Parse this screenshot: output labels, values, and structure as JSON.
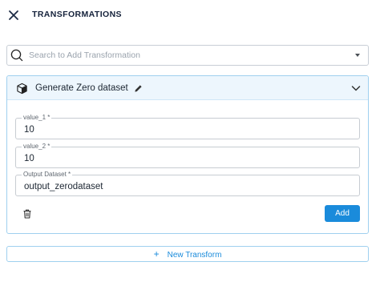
{
  "header": {
    "title": "TRANSFORMATIONS"
  },
  "search": {
    "placeholder": "Search to Add Transformation"
  },
  "card": {
    "title": "Generate Zero dataset",
    "fields": [
      {
        "label": "value_1 *",
        "value": "10"
      },
      {
        "label": "value_2 *",
        "value": "10"
      },
      {
        "label": "Output Dataset *",
        "value": "output_zerodataset"
      }
    ],
    "add_label": "Add"
  },
  "footer": {
    "plus": "+",
    "new_transform_label": "New Transform"
  },
  "colors": {
    "accent": "#1a8bdb",
    "card_border": "#9fd0ef",
    "card_header_bg": "#edf6fd"
  },
  "icons": [
    "close-icon",
    "search-icon",
    "chevron-down-icon",
    "cube-icon",
    "pencil-icon",
    "chevron-up-icon",
    "trash-icon",
    "plus-icon"
  ]
}
